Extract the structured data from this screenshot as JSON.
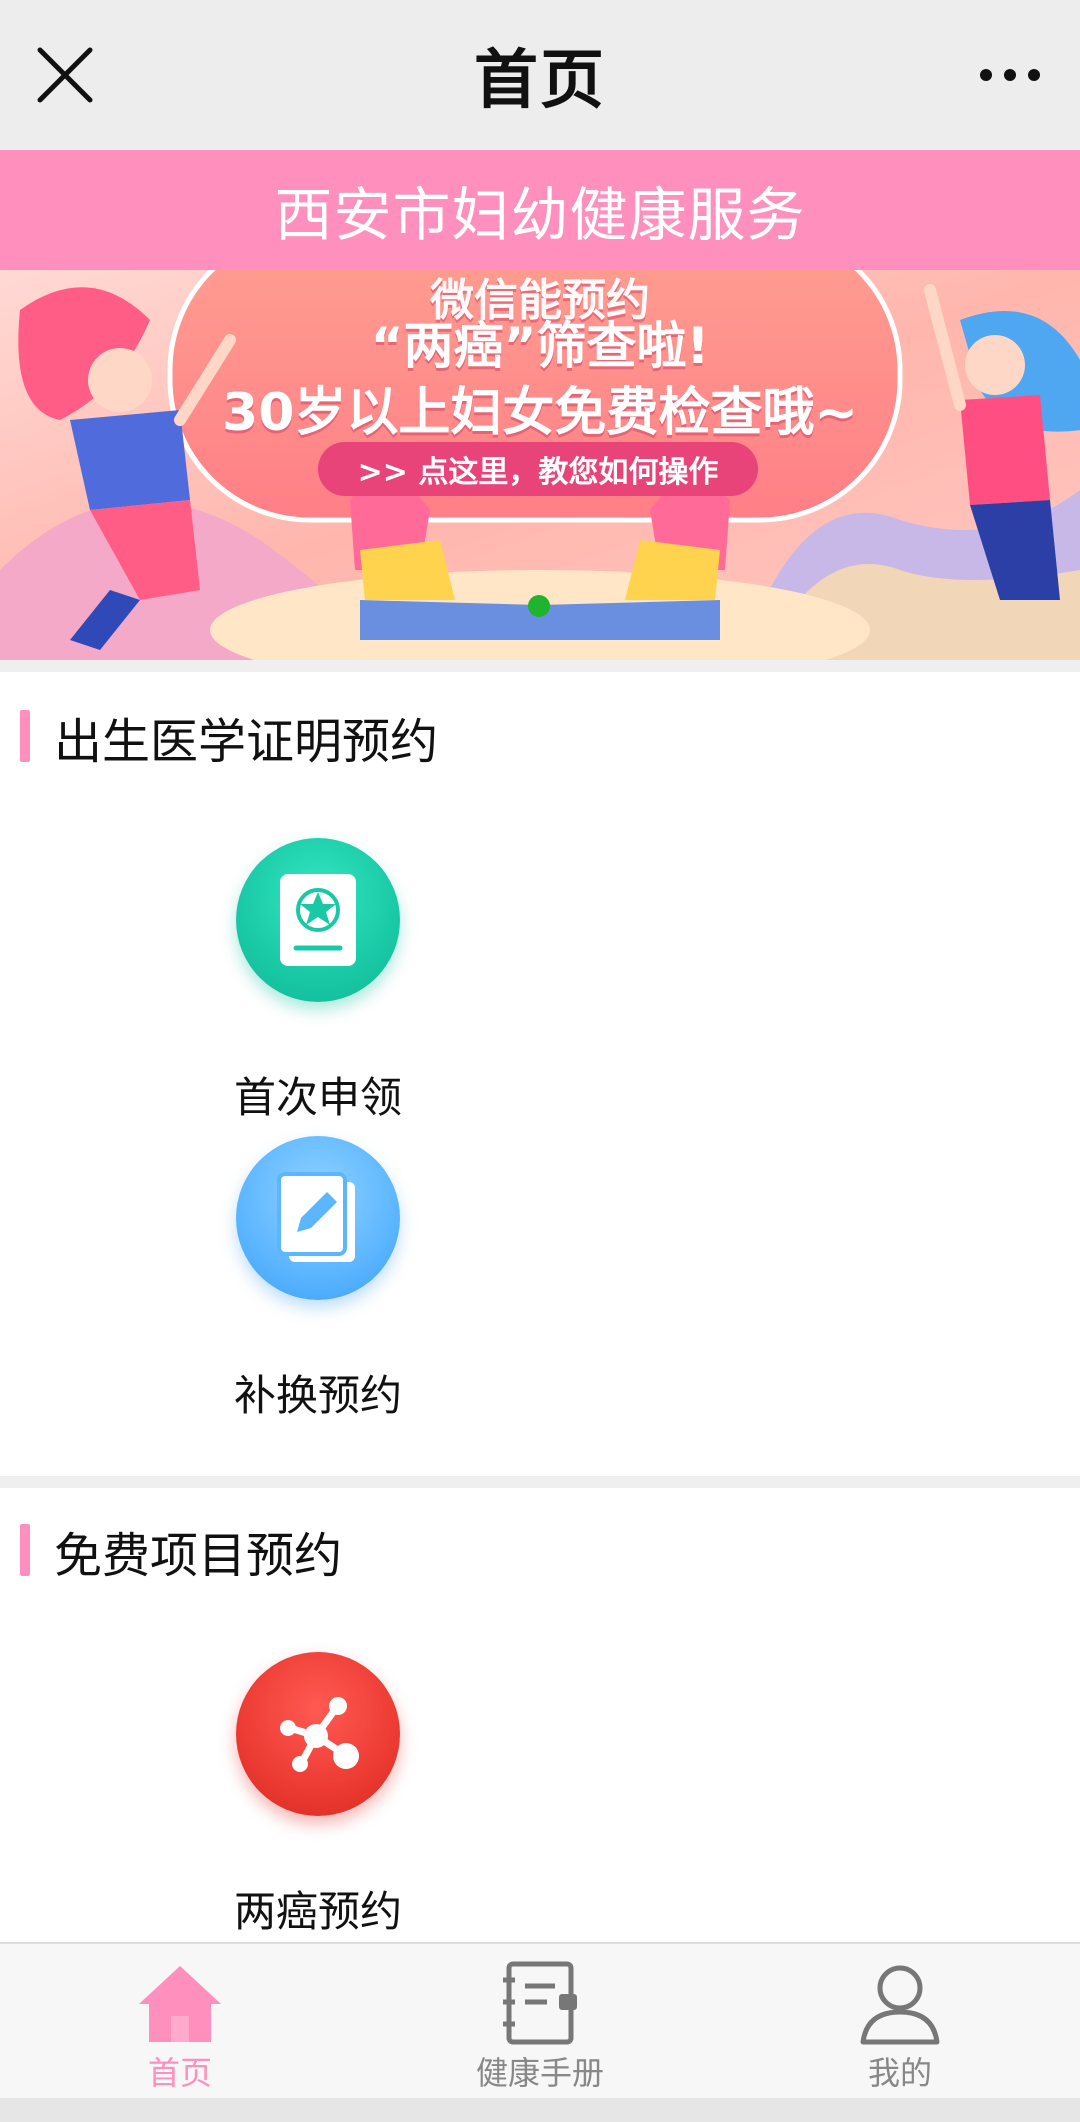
{
  "navbar": {
    "title": "首页"
  },
  "header": {
    "title": "西安市妇幼健康服务"
  },
  "banner": {
    "line1": "微信能预约",
    "line2": "“两癌”筛查啦!",
    "line3": "30岁以上妇女免费检查哦~",
    "pill": ">> 点这里，教您如何操作"
  },
  "sections": [
    {
      "title": "出生医学证明预约",
      "items": [
        {
          "label": "首次申领",
          "icon": "certificate-icon"
        },
        {
          "label": "补换预约",
          "icon": "edit-note-icon"
        }
      ]
    },
    {
      "title": "免费项目预约",
      "items": [
        {
          "label": "两癌预约",
          "icon": "network-nodes-icon"
        }
      ]
    }
  ],
  "tabbar": {
    "items": [
      {
        "label": "首页",
        "active": true
      },
      {
        "label": "健康手册",
        "active": false
      },
      {
        "label": "我的",
        "active": false
      }
    ]
  },
  "colors": {
    "accent": "#ff8fbd",
    "navbar_bg": "#ededed",
    "teal": "#19c9a6",
    "blue": "#5cb6ff",
    "red": "#ec3b33",
    "carousel_dot": "#1fb32e"
  }
}
